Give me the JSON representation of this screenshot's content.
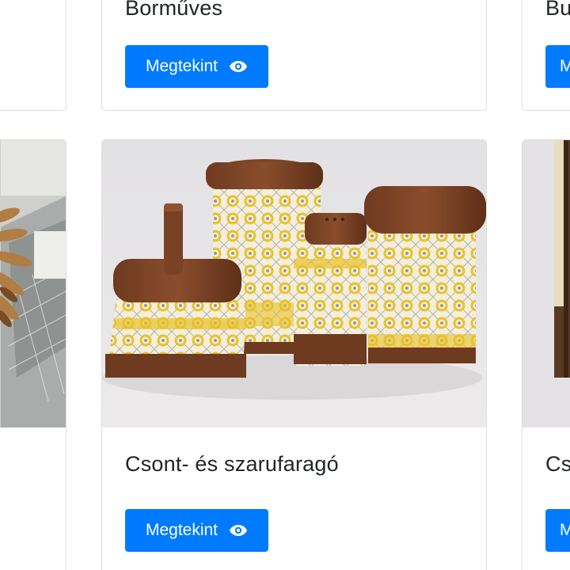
{
  "cards": {
    "top_left": {},
    "top_middle": {
      "title": "Borműves",
      "button_label": "Megtekint",
      "button_icon": "eye-icon"
    },
    "top_right": {
      "title": "Bu",
      "button_label": "M",
      "button_icon": "eye-icon"
    },
    "mid_left": {
      "image": "lace-making-photo"
    },
    "mid_middle": {
      "title": "Csont- és szarufaragó",
      "button_label": "Megtekint",
      "button_icon": "eye-icon",
      "image": "carved-containers-photo"
    },
    "mid_right": {
      "title": "Cs",
      "button_label": "M",
      "button_icon": "eye-icon",
      "image": "wooden-object-photo"
    }
  },
  "colors": {
    "button": "#007bff",
    "card_border": "#dedede",
    "title_text": "#212529"
  }
}
